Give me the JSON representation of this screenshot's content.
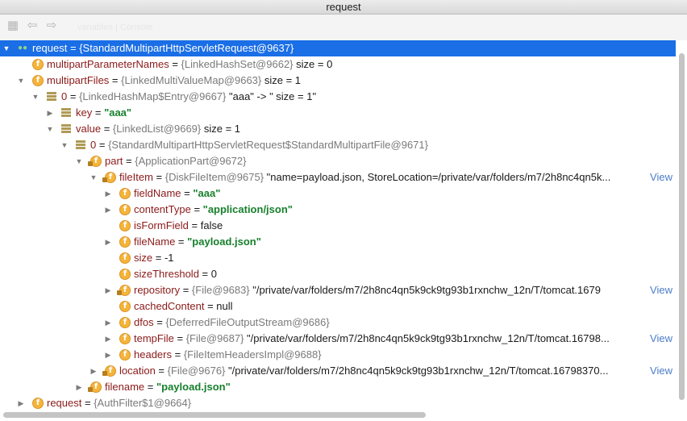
{
  "window": {
    "title": "request"
  },
  "toolbar": {
    "icons": [
      "layout-icon",
      "back-icon",
      "forward-icon"
    ],
    "ghost_text": "variables | Console"
  },
  "tree": {
    "rows": [
      {
        "name": "request",
        "sep": " = ",
        "value": "{StandardMultipartHttpServletRequest@9637}",
        "extra": "",
        "view": ""
      },
      {
        "name": "multipartParameterNames",
        "sep": " = ",
        "value": "{LinkedHashSet@9662}",
        "extra": " size = 0",
        "view": ""
      },
      {
        "name": "multipartFiles",
        "sep": " = ",
        "value": "{LinkedMultiValueMap@9663}",
        "extra": " size = 1",
        "view": ""
      },
      {
        "name": "0",
        "sep": " = ",
        "value": "{LinkedHashMap$Entry@9667}",
        "extra": " \"aaa\" -> \" size = 1\"",
        "view": ""
      },
      {
        "name": "key",
        "sep": " = ",
        "value": "\"aaa\"",
        "extra": "",
        "view": ""
      },
      {
        "name": "value",
        "sep": " = ",
        "value": "{LinkedList@9669}",
        "extra": " size = 1",
        "view": ""
      },
      {
        "name": "0",
        "sep": " = ",
        "value": "{StandardMultipartHttpServletRequest$StandardMultipartFile@9671}",
        "extra": "",
        "view": ""
      },
      {
        "name": "part",
        "sep": " = ",
        "value": "{ApplicationPart@9672}",
        "extra": "",
        "view": ""
      },
      {
        "name": "fileItem",
        "sep": " = ",
        "value": "{DiskFileItem@9675}",
        "extra": " \"name=payload.json, StoreLocation=/private/var/folders/m7/2h8nc4qn5k...",
        "view": "View"
      },
      {
        "name": "fieldName",
        "sep": " = ",
        "value": "\"aaa\"",
        "extra": "",
        "view": ""
      },
      {
        "name": "contentType",
        "sep": " = ",
        "value": "\"application/json\"",
        "extra": "",
        "view": ""
      },
      {
        "name": "isFormField",
        "sep": " = ",
        "value": "false",
        "extra": "",
        "view": ""
      },
      {
        "name": "fileName",
        "sep": " = ",
        "value": "\"payload.json\"",
        "extra": "",
        "view": ""
      },
      {
        "name": "size",
        "sep": " = ",
        "value": "-1",
        "extra": "",
        "view": ""
      },
      {
        "name": "sizeThreshold",
        "sep": " = ",
        "value": "0",
        "extra": "",
        "view": ""
      },
      {
        "name": "repository",
        "sep": " = ",
        "value": "{File@9683}",
        "extra": " \"/private/var/folders/m7/2h8nc4qn5k9ck9tg93b1rxnchw_12n/T/tomcat.1679",
        "view": "View"
      },
      {
        "name": "cachedContent",
        "sep": " = ",
        "value": "null",
        "extra": "",
        "view": ""
      },
      {
        "name": "dfos",
        "sep": " = ",
        "value": "{DeferredFileOutputStream@9686}",
        "extra": "",
        "view": ""
      },
      {
        "name": "tempFile",
        "sep": " = ",
        "value": "{File@9687}",
        "extra": " \"/private/var/folders/m7/2h8nc4qn5k9ck9tg93b1rxnchw_12n/T/tomcat.16798...",
        "view": "View"
      },
      {
        "name": "headers",
        "sep": " = ",
        "value": "{FileItemHeadersImpl@9688}",
        "extra": "",
        "view": ""
      },
      {
        "name": "location",
        "sep": " = ",
        "value": "{File@9676}",
        "extra": " \"/private/var/folders/m7/2h8nc4qn5k9ck9tg93b1rxnchw_12n/T/tomcat.16798370...",
        "view": "View"
      },
      {
        "name": "filename",
        "sep": " = ",
        "value": "\"payload.json\"",
        "extra": "",
        "view": ""
      },
      {
        "name": "request",
        "sep": " = ",
        "value": "{AuthFilter$1@9664}",
        "extra": "",
        "view": ""
      }
    ]
  },
  "colors": {
    "selection": "#1a6ee6",
    "field_icon": "#f5b43a",
    "string_value": "#17802c",
    "field_name": "#8b1a1a",
    "type_gray": "#7a7a7a",
    "link": "#4a7cc8"
  }
}
